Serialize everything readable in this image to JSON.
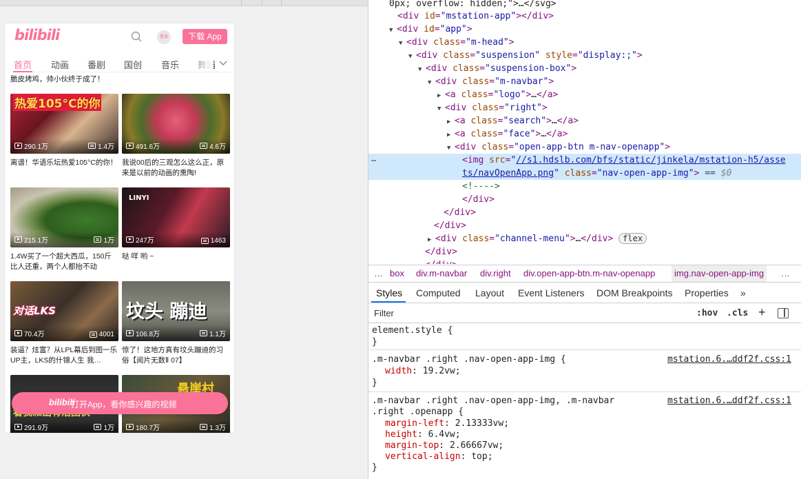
{
  "phone": {
    "logo": "bilibili",
    "face_label": "登录",
    "open_app_label": "下载 App",
    "channels": [
      "首页",
      "动画",
      "番剧",
      "国创",
      "音乐",
      "舞蹈"
    ],
    "prev_title": "脆皮烤鸡，帅小伙终于成了！",
    "cards": [
      {
        "views": "290.1万",
        "danmaku": "1.4万",
        "title": "离谱！华语乐坛热爱105°C的你！",
        "thumb_text": "热爱105°C的你"
      },
      {
        "views": "491.6万",
        "danmaku": "4.6万",
        "title": "我说00后的三观怎么这么正，原来是以前的动画的熏陶!",
        "thumb_text": ""
      },
      {
        "views": "215.1万",
        "danmaku": "1万",
        "title": "1.4W买了一个超大西瓜，150斤比人还重，两个人都抬不动",
        "thumb_text": ""
      },
      {
        "views": "247万",
        "danmaku": "1463",
        "title": "哒 咩 哟 ~",
        "thumb_text": "LINYI"
      },
      {
        "views": "70.4万",
        "danmaku": "4001",
        "title": "装逼？炫富？从LPL幕后到图一乐UP主，LKS的什锦人生 我…",
        "thumb_text": "对话LKS"
      },
      {
        "views": "106.8万",
        "danmaku": "1.1万",
        "title": "惊了！这地方真有坟头蹦迪的习俗【阅片无数Ⅱ 07】",
        "thumb_text": "坟头 蹦迪"
      },
      {
        "views": "291.9万",
        "danmaku": "1万",
        "title": "",
        "thumb_text": "看我派出有沿团伙"
      },
      {
        "views": "180.7万",
        "danmaku": "1.3万",
        "title": "",
        "thumb_text": "悬崖村"
      }
    ],
    "banner_logo": "bilibili",
    "banner_text": "打开App，看你感兴趣的视频",
    "accent": "#fb7299"
  },
  "devtools": {
    "dom_line0": "0px; overflow: hidden;\">…</svg>",
    "ellipsis": "…",
    "breadcrumbs": [
      "…",
      "box",
      "div.m-navbar",
      "div.right",
      "div.open-app-btn.m-nav-openapp",
      "img.nav-open-app-img",
      "…"
    ],
    "tabs": [
      "Styles",
      "Computed",
      "Layout",
      "Event Listeners",
      "DOM Breakpoints",
      "Properties",
      "»"
    ],
    "filter_placeholder": "Filter",
    "hov": ":hov",
    "cls": ".cls",
    "plus": "+",
    "rule1": {
      "selector": "element.style {",
      "close": "}"
    },
    "rule2": {
      "selector": ".m-navbar .right .nav-open-app-img {",
      "source": "mstation.6.…ddf2f.css:1",
      "prop": "width",
      "val": "19.2vw;",
      "close": "}"
    },
    "rule3": {
      "selector1": ".m-navbar .right .nav-open-app-img, .m-navbar",
      "selector2": ".right .openapp {",
      "source": "mstation.6.…ddf2f.css:1",
      "props": [
        [
          "margin-left",
          "2.13333vw;"
        ],
        [
          "height",
          "6.4vw;"
        ],
        [
          "margin-top",
          "2.66667vw;"
        ],
        [
          "vertical-align",
          "top;"
        ]
      ],
      "close": "}"
    }
  }
}
